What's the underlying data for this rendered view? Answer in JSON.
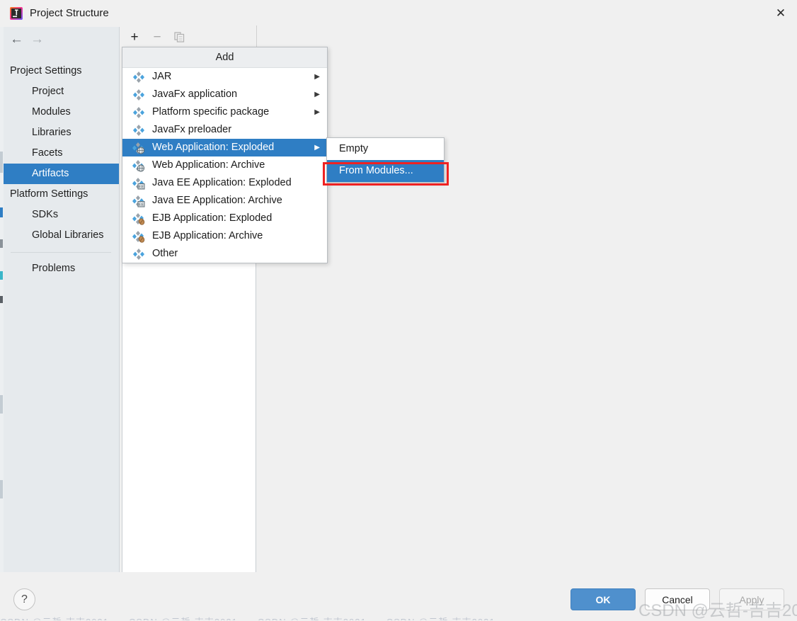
{
  "window": {
    "title": "Project Structure",
    "app_icon": "intellij-idea-icon",
    "close_label": "✕"
  },
  "nav": {
    "back": "←",
    "forward": "→"
  },
  "sidebar": {
    "items": [
      {
        "label": "Project Settings",
        "type": "group",
        "selected": false
      },
      {
        "label": "Project",
        "type": "child",
        "selected": false
      },
      {
        "label": "Modules",
        "type": "child",
        "selected": false
      },
      {
        "label": "Libraries",
        "type": "child",
        "selected": false
      },
      {
        "label": "Facets",
        "type": "child",
        "selected": false
      },
      {
        "label": "Artifacts",
        "type": "child",
        "selected": true
      },
      {
        "label": "Platform Settings",
        "type": "group",
        "selected": false
      },
      {
        "label": "SDKs",
        "type": "child",
        "selected": false
      },
      {
        "label": "Global Libraries",
        "type": "child",
        "selected": false
      },
      {
        "label": "Problems",
        "type": "child",
        "selected": false
      }
    ]
  },
  "toolbar": {
    "add_label": "+",
    "remove_label": "−",
    "copy_label": "copy-icon"
  },
  "add_menu": {
    "title": "Add",
    "items": [
      {
        "label": "JAR",
        "icon": "artifact-icon",
        "arrow": true,
        "selected": false
      },
      {
        "label": "JavaFx application",
        "icon": "artifact-icon",
        "arrow": true,
        "selected": false
      },
      {
        "label": "Platform specific package",
        "icon": "artifact-icon",
        "arrow": true,
        "selected": false
      },
      {
        "label": "JavaFx preloader",
        "icon": "artifact-icon",
        "arrow": false,
        "selected": false
      },
      {
        "label": "Web Application: Exploded",
        "icon": "web-artifact-icon",
        "arrow": true,
        "selected": true
      },
      {
        "label": "Web Application: Archive",
        "icon": "web-artifact-icon",
        "arrow": false,
        "selected": false
      },
      {
        "label": "Java EE Application: Exploded",
        "icon": "javaee-artifact-icon",
        "arrow": false,
        "selected": false
      },
      {
        "label": "Java EE Application: Archive",
        "icon": "javaee-artifact-icon",
        "arrow": false,
        "selected": false
      },
      {
        "label": "EJB Application: Exploded",
        "icon": "ejb-artifact-icon",
        "arrow": false,
        "selected": false
      },
      {
        "label": "EJB Application: Archive",
        "icon": "ejb-artifact-icon",
        "arrow": false,
        "selected": false
      },
      {
        "label": "Other",
        "icon": "artifact-icon",
        "arrow": false,
        "selected": false
      }
    ]
  },
  "submenu": {
    "items": [
      {
        "label": "Empty",
        "selected": false
      },
      {
        "label": "From Modules...",
        "selected": true
      }
    ]
  },
  "footer": {
    "help_label": "?",
    "ok_label": "OK",
    "cancel_label": "Cancel",
    "apply_label": "Apply"
  },
  "watermark": {
    "text": "CSDN @云哲-吉吉2021"
  },
  "colors": {
    "accent": "#2f7ec4",
    "ok_button": "#4f90cd",
    "annotation": "#ef2222",
    "sidebar_bg": "#e6eaed",
    "dialog_bg": "#f0f0f0"
  }
}
